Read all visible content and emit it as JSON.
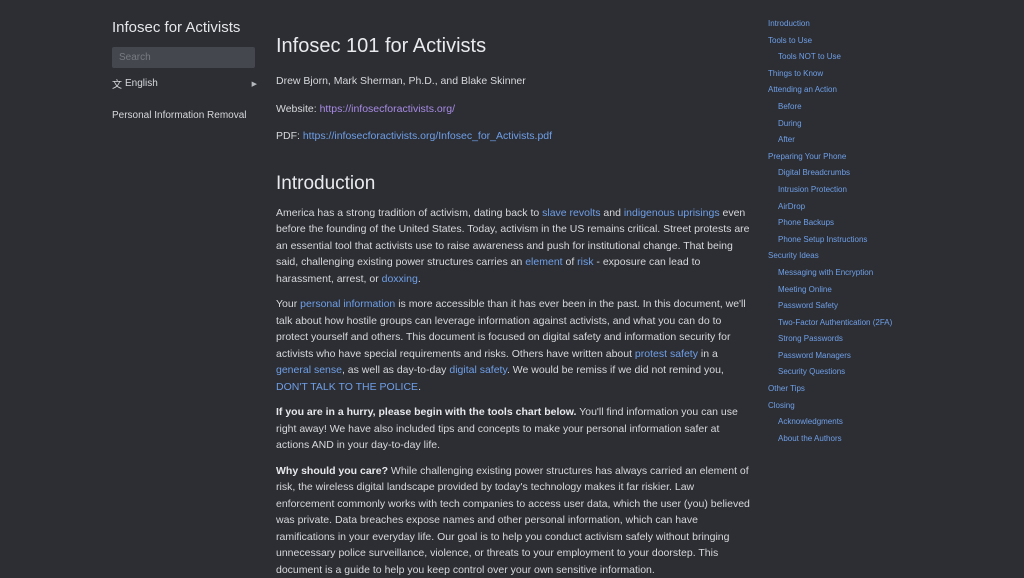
{
  "sidebar": {
    "site_title": "Infosec for Activists",
    "search_placeholder": "Search",
    "language": "English",
    "links": [
      "Personal Information Removal"
    ]
  },
  "main": {
    "title": "Infosec 101 for Activists",
    "authors": "Drew Bjorn, Mark Sherman, Ph.D., and Blake Skinner",
    "website_label": "Website:",
    "website_url": "https://infosecforactivists.org/",
    "pdf_label": "PDF:",
    "pdf_url": "https://infosecforactivists.org/Infosec_for_Activists.pdf",
    "intro_heading": "Introduction",
    "p1": {
      "t1": "America has a strong tradition of activism, dating back to ",
      "l1": "slave revolts",
      "t2": " and ",
      "l2": "indigenous uprisings",
      "t3": " even before the founding of the United States. Today, activism in the US remains critical. Street protests are an essential tool that activists use to raise awareness and push for institutional change. That being said, challenging existing power structures carries an ",
      "l3": "element",
      "t4": " of ",
      "l4": "risk",
      "t5": " - exposure can lead to harassment, arrest, or ",
      "l5": "doxxing",
      "t6": "."
    },
    "p2": {
      "t1": "Your ",
      "l1": "personal information",
      "t2": " is more accessible than it has ever been in the past. In this document, we'll talk about how hostile groups can leverage information against activists, and what you can do to protect yourself and others. This document is focused on digital safety and information security for activists who have special requirements and risks. Others have written about ",
      "l2": "protest safety",
      "t3": " in a ",
      "l3": "general sense",
      "t4": ", as well as day-to-day ",
      "l4": "digital safety",
      "t5": ". We would be remiss if we did not remind you, ",
      "l5": "DON'T TALK TO THE POLICE",
      "t6": "."
    },
    "p3": {
      "bold": "If you are in a hurry, please begin with the tools chart below.",
      "text": " You'll find information you can use right away! We have also included tips and concepts to make your personal information safer at actions AND in your day-to-day life."
    },
    "p4": {
      "bold": "Why should you care?",
      "text": " While challenging existing power structures has always carried an element of risk, the wireless digital landscape provided by today's technology makes it far riskier. Law enforcement commonly works with tech companies to access user data, which the user (you) believed was private. Data breaches expose names and other personal information, which can have ramifications in your everyday life. Our goal is to help you conduct activism safely without bringing unnecessary police surveillance, violence, or threats to your employment to your doorstep. This document is a guide to help you keep control over your own sensitive information."
    }
  },
  "toc": {
    "items": [
      {
        "label": "Introduction",
        "level": 1
      },
      {
        "label": "Tools to Use",
        "level": 1
      },
      {
        "label": "Tools NOT to Use",
        "level": 2
      },
      {
        "label": "Things to Know",
        "level": 1
      },
      {
        "label": "Attending an Action",
        "level": 1
      },
      {
        "label": "Before",
        "level": 2
      },
      {
        "label": "During",
        "level": 2
      },
      {
        "label": "After",
        "level": 2
      },
      {
        "label": "Preparing Your Phone",
        "level": 1
      },
      {
        "label": "Digital Breadcrumbs",
        "level": 2
      },
      {
        "label": "Intrusion Protection",
        "level": 2
      },
      {
        "label": "AirDrop",
        "level": 2
      },
      {
        "label": "Phone Backups",
        "level": 2
      },
      {
        "label": "Phone Setup Instructions",
        "level": 2
      },
      {
        "label": "Security Ideas",
        "level": 1
      },
      {
        "label": "Messaging with Encryption",
        "level": 2
      },
      {
        "label": "Meeting Online",
        "level": 2
      },
      {
        "label": "Password Safety",
        "level": 2
      },
      {
        "label": "Two-Factor Authentication (2FA)",
        "level": 2
      },
      {
        "label": "Strong Passwords",
        "level": 2
      },
      {
        "label": "Password Managers",
        "level": 2
      },
      {
        "label": "Security Questions",
        "level": 2
      },
      {
        "label": "Other Tips",
        "level": 1
      },
      {
        "label": "Closing",
        "level": 1
      },
      {
        "label": "Acknowledgments",
        "level": 2
      },
      {
        "label": "About the Authors",
        "level": 2
      }
    ]
  },
  "colors": {
    "background": "#2c2e33",
    "text": "#d6d8dc",
    "link": "#6f9fe8",
    "visited_link": "#a98be6"
  }
}
